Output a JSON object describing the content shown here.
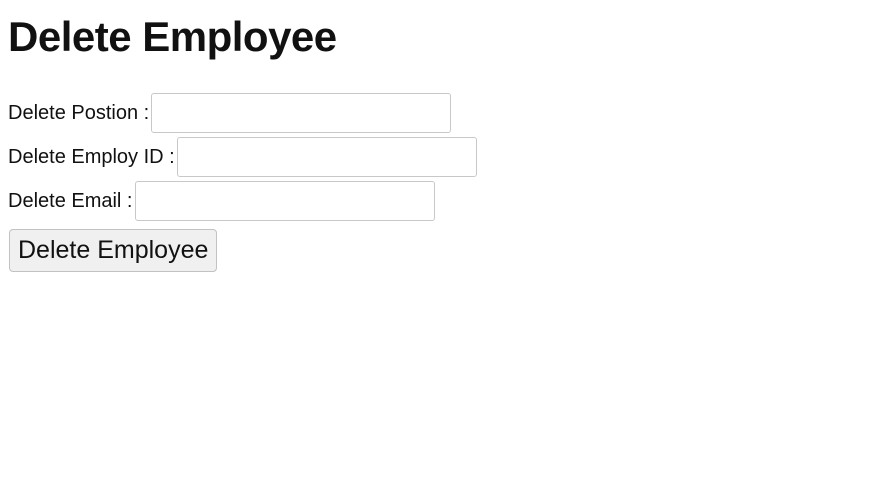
{
  "page": {
    "title": "Delete Employee"
  },
  "form": {
    "fields": [
      {
        "label": "Delete Postion :",
        "value": "",
        "placeholder": ""
      },
      {
        "label": "Delete Employ ID :",
        "value": "",
        "placeholder": ""
      },
      {
        "label": "Delete Email :",
        "value": "",
        "placeholder": ""
      }
    ],
    "submit_label": "Delete Employee"
  },
  "colors": {
    "background": "#ffffff",
    "text": "#111111",
    "input_border": "#c8c8c8",
    "button_background": "#f0f0f0",
    "button_border": "#c2c2c2"
  }
}
